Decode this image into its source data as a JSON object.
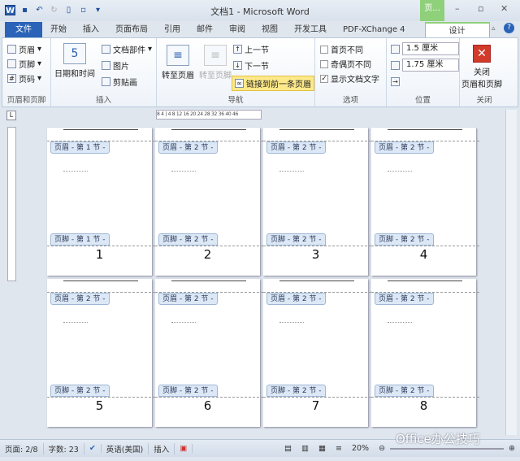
{
  "window": {
    "title": "文档1 - Microsoft Word",
    "context_tab": "页..."
  },
  "tabs": [
    {
      "label": "文件"
    },
    {
      "label": "开始"
    },
    {
      "label": "插入"
    },
    {
      "label": "页面布局"
    },
    {
      "label": "引用"
    },
    {
      "label": "邮件"
    },
    {
      "label": "审阅"
    },
    {
      "label": "视图"
    },
    {
      "label": "开发工具"
    },
    {
      "label": "PDF-XChange 4"
    },
    {
      "label": "设计"
    }
  ],
  "ribbon": {
    "hf": {
      "header": "页眉",
      "footer": "页脚",
      "pagenum": "页码",
      "label": "页眉和页脚"
    },
    "insert": {
      "datetime": "日期和时间",
      "docparts": "文档部件",
      "picture": "图片",
      "clipart": "剪贴画",
      "label": "插入"
    },
    "nav": {
      "goto_header": "转至页眉",
      "goto_footer": "转至页脚",
      "prev": "上一节",
      "next": "下一节",
      "link_prev": "链接到前一条页眉",
      "label": "导航"
    },
    "options": {
      "first_diff": "首页不同",
      "odd_even": "奇偶页不同",
      "show_text": "显示文档文字",
      "label": "选项"
    },
    "position": {
      "header_pos": "1.5 厘米",
      "footer_pos": "1.75 厘米",
      "label": "位置"
    },
    "close": {
      "btn": "关闭\n页眉和页脚",
      "label": "关闭"
    }
  },
  "ruler": {
    "text": "8 4 | 4 8 12 16 20 24 28 32 36 40 46"
  },
  "pages": [
    {
      "number": "1",
      "header": "页眉 - 第 1 节 -",
      "footer": "页脚 - 第 1 节 -"
    },
    {
      "number": "2",
      "header": "页眉 - 第 2 节 -",
      "footer": "页脚 - 第 2 节 -"
    },
    {
      "number": "3",
      "header": "页眉 - 第 2 节 -",
      "footer": "页脚 - 第 2 节 -"
    },
    {
      "number": "4",
      "header": "页眉 - 第 2 节 -",
      "footer": "页脚 - 第 2 节 -"
    },
    {
      "number": "5",
      "header": "页眉 - 第 2 节 -",
      "footer": "页脚 - 第 2 节 -"
    },
    {
      "number": "6",
      "header": "页眉 - 第 2 节 -",
      "footer": "页脚 - 第 2 节 -"
    },
    {
      "number": "7",
      "header": "页眉 - 第 2 节 -",
      "footer": "页脚 - 第 2 节 -"
    },
    {
      "number": "8",
      "header": "页眉 - 第 2 节 -",
      "footer": "页脚 - 第 2 节 -"
    }
  ],
  "status": {
    "page": "页面: 2/8",
    "words": "字数: 23",
    "lang": "英语(美国)",
    "mode": "插入",
    "zoom": "20%"
  },
  "watermark": "Office办公技巧"
}
